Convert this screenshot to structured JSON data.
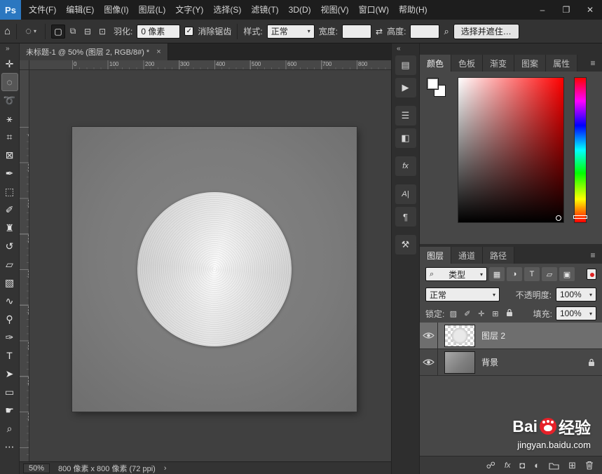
{
  "titlebar": {
    "app_icon": "Ps",
    "menus": [
      "文件(F)",
      "编辑(E)",
      "图像(I)",
      "图层(L)",
      "文字(Y)",
      "选择(S)",
      "滤镜(T)",
      "3D(D)",
      "视图(V)",
      "窗口(W)",
      "帮助(H)"
    ],
    "window_controls": {
      "minimize": "–",
      "maximize": "❐",
      "close": "✕"
    }
  },
  "ui": {
    "caret_down": "▾",
    "menu_icon": "≡",
    "check_glyph": "✓"
  },
  "options_bar": {
    "home_icon": "⌂",
    "tool_icon": "◌",
    "mode_buttons": [
      {
        "name": "new-selection",
        "glyph": "▢"
      },
      {
        "name": "add-to-selection",
        "glyph": "⧉"
      },
      {
        "name": "subtract-from-selection",
        "glyph": "⊟"
      },
      {
        "name": "intersect-selection",
        "glyph": "⊡"
      }
    ],
    "feather_label": "羽化:",
    "feather_value": "0 像素",
    "antialias_label": "消除锯齿",
    "style_label": "样式:",
    "style_value": "正常",
    "width_label": "宽度:",
    "width_value": "",
    "swap_icon": "⇄",
    "height_label": "高度:",
    "height_value": "",
    "search_icon": "⌕",
    "select_mask_button": "选择并遮住…"
  },
  "toolbar": {
    "collapse_glyph": "»",
    "tools": [
      {
        "name": "move-tool",
        "glyph": "✛"
      },
      {
        "name": "elliptical-marquee-tool",
        "glyph": "◌"
      },
      {
        "name": "lasso-tool",
        "glyph": "➰"
      },
      {
        "name": "magic-wand-tool",
        "glyph": "⚹"
      },
      {
        "name": "crop-tool",
        "glyph": "⌗"
      },
      {
        "name": "frame-tool",
        "glyph": "⊠"
      },
      {
        "name": "eyedropper-tool",
        "glyph": "✒"
      },
      {
        "name": "healing-brush-tool",
        "glyph": "⬚"
      },
      {
        "name": "brush-tool",
        "glyph": "✐"
      },
      {
        "name": "clone-stamp-tool",
        "glyph": "♜"
      },
      {
        "name": "history-brush-tool",
        "glyph": "↺"
      },
      {
        "name": "eraser-tool",
        "glyph": "▱"
      },
      {
        "name": "gradient-tool",
        "glyph": "▧"
      },
      {
        "name": "smudge-tool",
        "glyph": "∿"
      },
      {
        "name": "dodge-tool",
        "glyph": "⚲"
      },
      {
        "name": "pen-tool",
        "glyph": "✑"
      },
      {
        "name": "type-tool",
        "glyph": "T"
      },
      {
        "name": "path-selection-tool",
        "glyph": "➤"
      },
      {
        "name": "rectangle-tool",
        "glyph": "▭"
      },
      {
        "name": "hand-tool",
        "glyph": "☛"
      },
      {
        "name": "zoom-tool",
        "glyph": "⌕"
      },
      {
        "name": "edit-toolbar",
        "glyph": "⋯"
      }
    ]
  },
  "document": {
    "tab_title": "未标题-1 @ 50% (图层 2, RGB/8#) *",
    "tab_close": "×",
    "ruler_numbers": [
      "0",
      "100",
      "200",
      "300",
      "400",
      "500",
      "600",
      "700",
      "800"
    ],
    "status_zoom": "50%",
    "status_info": "800 像素 x 800 像素 (72 ppi)",
    "status_chevron": "›"
  },
  "panel_strip": {
    "collapse_glyph": "«",
    "icons": [
      {
        "name": "history-panel-icon",
        "glyph": "▤"
      },
      {
        "name": "actions-panel-icon",
        "glyph": "▶"
      },
      {
        "name": "properties-panel-icon",
        "glyph": "☰"
      },
      {
        "name": "adjustments-panel-icon",
        "glyph": "◧"
      },
      {
        "name": "styles-panel-icon",
        "glyph": "fx"
      },
      {
        "name": "character-panel-icon",
        "glyph": "A|"
      },
      {
        "name": "paragraph-panel-icon",
        "glyph": "¶"
      },
      {
        "name": "tool-presets-panel-icon",
        "glyph": "⚒"
      }
    ]
  },
  "color_panel": {
    "tabs": [
      "颜色",
      "色板",
      "渐变",
      "图案",
      "属性"
    ]
  },
  "layers_panel": {
    "tabs": [
      "图层",
      "通道",
      "路径"
    ],
    "filter_label": "类型",
    "filter_icons": [
      {
        "name": "filter-image-layers-icon",
        "glyph": "▦"
      },
      {
        "name": "filter-adjustment-layers-icon",
        "glyph": "◑"
      },
      {
        "name": "filter-type-layers-icon",
        "glyph": "T"
      },
      {
        "name": "filter-shape-layers-icon",
        "glyph": "▱"
      },
      {
        "name": "filter-smart-objects-icon",
        "glyph": "▣"
      }
    ],
    "blend_mode": "正常",
    "opacity_label": "不透明度:",
    "opacity_value": "100%",
    "lock_label": "锁定:",
    "lock_icons": [
      {
        "name": "lock-transparent-pixels-icon",
        "glyph": "▨"
      },
      {
        "name": "lock-image-pixels-icon",
        "glyph": "✐"
      },
      {
        "name": "lock-position-icon",
        "glyph": "✛"
      },
      {
        "name": "lock-artboard-icon",
        "glyph": "⊞"
      }
    ],
    "fill_label": "填充:",
    "fill_value": "100%",
    "layers": [
      {
        "name": "图层 2"
      },
      {
        "name": "背景"
      }
    ],
    "footer": {
      "link": "☍",
      "styles": "fx",
      "mask": "◘",
      "adjustment": "◐",
      "new_layer": "⊞"
    }
  },
  "watermark": {
    "brand_prefix": "Bai",
    "brand_suffix": "经验",
    "url": "jingyan.baidu.com"
  }
}
